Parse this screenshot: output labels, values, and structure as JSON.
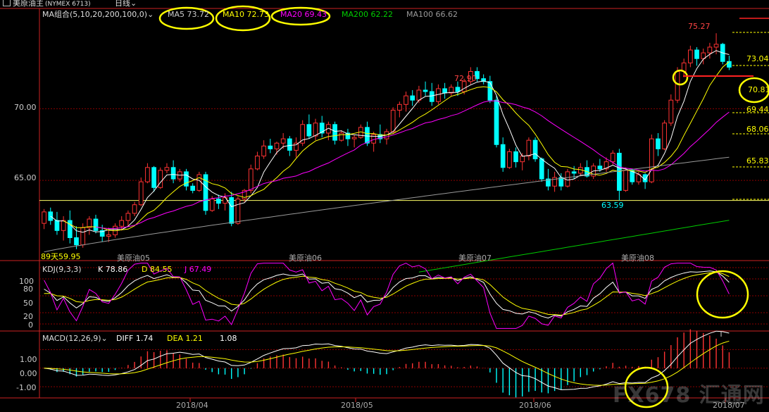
{
  "header": {
    "title": "美原油主",
    "code": "(NYMEX 6713)",
    "period": "日线",
    "dropdown_icon": "chevron-down-icon"
  },
  "ma_legend": {
    "group": "MA组合(5,10,20,200,100,0)",
    "items": [
      {
        "label": "MA5 73.72",
        "color": "#ffffff"
      },
      {
        "label": "MA10 72.73",
        "color": "#ffff00"
      },
      {
        "label": "MA20 69.43",
        "color": "#ff00ff"
      },
      {
        "label": "MA200 62.22",
        "color": "#00cc00"
      },
      {
        "label": "MA100 66.62",
        "color": "#999999"
      }
    ]
  },
  "kdj_legend": {
    "name": "KDJ(9,3,3)",
    "items": [
      {
        "label": "K 78.86",
        "color": "#ffffff"
      },
      {
        "label": "D 84.55",
        "color": "#ffff00"
      },
      {
        "label": "J 67.49",
        "color": "#ff00ff"
      }
    ]
  },
  "macd_legend": {
    "name": "MACD(12,26,9)",
    "items": [
      {
        "label": "DIFF 1.74",
        "color": "#ffffff"
      },
      {
        "label": "DEA 1.21",
        "color": "#ffff00"
      },
      {
        "label": "1.08",
        "color": "#ffffff"
      }
    ]
  },
  "price_annotations": {
    "high1": "72.90",
    "high2": "75.27",
    "low1": "63.59",
    "left_low": "89天59.95"
  },
  "right_levels": [
    "73.04",
    "70.81",
    "69.44",
    "68.06",
    "65.83"
  ],
  "contract_labels": [
    "美原油05",
    "美原油06",
    "美原油07",
    "美原油08"
  ],
  "x_axis": [
    "2018/04",
    "2018/05",
    "2018/06",
    "2018/07"
  ],
  "price_axis": [
    "70.00",
    "65.00"
  ],
  "kdj_axis": [
    "100",
    "80",
    "50",
    "20",
    "0"
  ],
  "macd_axis": [
    "1.00",
    "0.00",
    "-1.00"
  ],
  "watermark": "FX678 汇通网",
  "colors": {
    "up": "#ff3333",
    "down": "#00ffff",
    "grid": "#8b0000",
    "axis": "#cc2222",
    "annotation": "#ffff00",
    "hline": "#ffff66"
  },
  "chart_data": {
    "type": "candlestick",
    "y_range": [
      59.5,
      77
    ],
    "ohlc": [
      [
        62.0,
        63.0,
        61.6,
        62.8
      ],
      [
        62.8,
        63.1,
        61.9,
        62.2
      ],
      [
        62.2,
        62.8,
        61.2,
        61.5
      ],
      [
        61.5,
        62.5,
        60.8,
        62.2
      ],
      [
        62.2,
        62.9,
        60.6,
        61.0
      ],
      [
        61.0,
        61.8,
        60.2,
        60.5
      ],
      [
        60.5,
        62.0,
        60.3,
        61.7
      ],
      [
        61.7,
        62.5,
        61.2,
        62.3
      ],
      [
        62.3,
        62.6,
        61.3,
        61.5
      ],
      [
        61.5,
        61.9,
        60.7,
        61.1
      ],
      [
        61.1,
        61.7,
        60.7,
        61.2
      ],
      [
        61.2,
        62.0,
        61.0,
        61.8
      ],
      [
        61.8,
        62.5,
        61.5,
        62.2
      ],
      [
        62.2,
        62.9,
        61.8,
        62.7
      ],
      [
        62.7,
        63.5,
        62.5,
        63.3
      ],
      [
        63.3,
        65.2,
        63.2,
        64.9
      ],
      [
        64.9,
        66.2,
        64.8,
        65.9
      ],
      [
        65.9,
        66.0,
        64.2,
        64.5
      ],
      [
        64.5,
        65.9,
        64.4,
        65.7
      ],
      [
        65.7,
        66.2,
        65.5,
        65.9
      ],
      [
        65.9,
        66.4,
        64.8,
        65.1
      ],
      [
        65.1,
        65.8,
        64.9,
        65.6
      ],
      [
        65.6,
        65.8,
        64.3,
        64.6
      ],
      [
        64.6,
        64.8,
        64.1,
        64.3
      ],
      [
        64.3,
        65.6,
        64.2,
        65.4
      ],
      [
        65.4,
        65.6,
        62.6,
        62.9
      ],
      [
        62.9,
        63.9,
        62.8,
        63.7
      ],
      [
        63.7,
        64.0,
        63.0,
        63.4
      ],
      [
        63.4,
        64.1,
        62.9,
        63.8
      ],
      [
        63.8,
        64.2,
        61.8,
        62.0
      ],
      [
        62.0,
        63.9,
        61.9,
        63.7
      ],
      [
        63.7,
        64.4,
        63.5,
        64.3
      ],
      [
        64.3,
        66.1,
        64.1,
        65.8
      ],
      [
        65.8,
        67.0,
        65.7,
        66.7
      ],
      [
        66.7,
        67.8,
        66.5,
        67.4
      ],
      [
        67.4,
        67.9,
        66.9,
        67.2
      ],
      [
        67.2,
        67.7,
        66.8,
        67.6
      ],
      [
        67.6,
        68.3,
        67.2,
        67.9
      ],
      [
        67.9,
        68.1,
        66.7,
        67.1
      ],
      [
        67.1,
        68.0,
        66.6,
        67.6
      ],
      [
        67.6,
        69.2,
        67.4,
        68.9
      ],
      [
        68.9,
        69.6,
        67.9,
        68.1
      ],
      [
        68.1,
        69.3,
        67.8,
        69.0
      ],
      [
        69.0,
        69.5,
        68.0,
        68.3
      ],
      [
        68.3,
        69.1,
        67.8,
        68.9
      ],
      [
        68.9,
        69.1,
        67.5,
        67.8
      ],
      [
        67.8,
        68.5,
        67.7,
        68.3
      ],
      [
        68.3,
        68.6,
        67.4,
        67.9
      ],
      [
        67.9,
        68.2,
        67.3,
        68.0
      ],
      [
        68.0,
        68.9,
        67.9,
        68.7
      ],
      [
        68.7,
        69.1,
        67.4,
        67.6
      ],
      [
        67.6,
        68.4,
        67.0,
        68.2
      ],
      [
        68.2,
        68.9,
        67.6,
        67.9
      ],
      [
        67.9,
        68.6,
        67.5,
        68.4
      ],
      [
        68.4,
        70.1,
        68.3,
        69.9
      ],
      [
        69.9,
        70.5,
        69.4,
        70.3
      ],
      [
        70.3,
        71.2,
        69.8,
        70.9
      ],
      [
        70.9,
        71.3,
        70.2,
        70.6
      ],
      [
        70.6,
        71.6,
        70.4,
        71.3
      ],
      [
        71.3,
        71.9,
        70.9,
        71.2
      ],
      [
        71.2,
        71.8,
        70.2,
        70.5
      ],
      [
        70.5,
        71.7,
        70.3,
        71.4
      ],
      [
        71.4,
        71.8,
        70.7,
        71.1
      ],
      [
        71.1,
        71.7,
        70.9,
        71.5
      ],
      [
        71.5,
        71.9,
        70.9,
        71.2
      ],
      [
        71.2,
        72.1,
        71.0,
        71.9
      ],
      [
        71.9,
        72.9,
        71.7,
        72.6
      ],
      [
        72.6,
        72.9,
        71.9,
        72.1
      ],
      [
        72.1,
        72.4,
        71.7,
        71.9
      ],
      [
        71.9,
        72.3,
        70.4,
        70.6
      ],
      [
        70.6,
        70.9,
        67.3,
        67.5
      ],
      [
        67.5,
        68.0,
        65.6,
        65.9
      ],
      [
        65.9,
        67.2,
        65.8,
        67.0
      ],
      [
        67.0,
        67.3,
        65.9,
        66.3
      ],
      [
        66.3,
        66.9,
        65.7,
        66.7
      ],
      [
        66.7,
        68.0,
        66.4,
        67.8
      ],
      [
        67.8,
        68.0,
        66.3,
        66.5
      ],
      [
        66.5,
        66.6,
        64.9,
        65.1
      ],
      [
        65.1,
        65.8,
        64.3,
        64.6
      ],
      [
        64.6,
        65.6,
        64.2,
        65.2
      ],
      [
        65.2,
        65.5,
        64.3,
        64.6
      ],
      [
        64.6,
        65.8,
        64.5,
        65.6
      ],
      [
        65.6,
        66.0,
        65.1,
        65.5
      ],
      [
        65.5,
        66.2,
        65.3,
        65.9
      ],
      [
        65.9,
        66.4,
        65.2,
        65.3
      ],
      [
        65.3,
        66.2,
        65.1,
        66.0
      ],
      [
        66.0,
        66.5,
        65.6,
        65.8
      ],
      [
        65.8,
        66.6,
        65.6,
        66.3
      ],
      [
        66.3,
        67.1,
        66.1,
        66.9
      ],
      [
        66.9,
        67.2,
        63.6,
        64.3
      ],
      [
        64.3,
        65.9,
        64.2,
        65.7
      ],
      [
        65.7,
        65.8,
        64.7,
        64.9
      ],
      [
        64.9,
        65.6,
        64.7,
        65.4
      ],
      [
        65.4,
        65.5,
        64.4,
        64.9
      ],
      [
        64.9,
        68.2,
        64.8,
        67.9
      ],
      [
        67.9,
        68.3,
        66.7,
        67.2
      ],
      [
        67.2,
        69.2,
        67.1,
        69.0
      ],
      [
        69.0,
        71.0,
        68.8,
        70.6
      ],
      [
        70.6,
        72.9,
        70.4,
        72.6
      ],
      [
        72.6,
        73.5,
        72.2,
        73.2
      ],
      [
        73.2,
        74.4,
        72.9,
        74.1
      ],
      [
        74.1,
        74.3,
        73.0,
        73.5
      ],
      [
        73.5,
        74.2,
        73.1,
        73.9
      ],
      [
        73.9,
        74.6,
        73.5,
        74.3
      ],
      [
        74.3,
        75.27,
        73.8,
        74.5
      ],
      [
        74.5,
        74.6,
        73.1,
        73.3
      ],
      [
        73.3,
        73.7,
        72.7,
        72.9
      ]
    ],
    "ma5_last": 73.72,
    "ma10_last": 72.73,
    "ma20_last": 69.43,
    "ma100_last": 66.62,
    "ma200_last": 62.22,
    "kdj_last": {
      "K": 78.86,
      "D": 84.55,
      "J": 67.49
    },
    "macd_last": {
      "DIFF": 1.74,
      "DEA": 1.21,
      "MACD": 1.08
    },
    "kdj_range": [
      -10,
      110
    ],
    "macd_range": [
      -1.6,
      2.0
    ]
  }
}
